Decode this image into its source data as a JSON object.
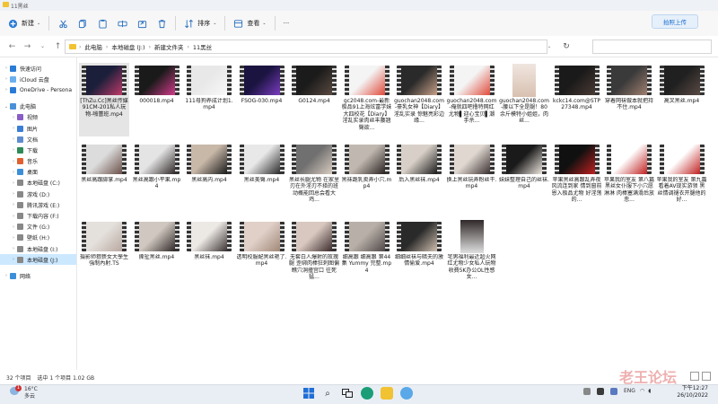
{
  "window": {
    "title": "11黑丝"
  },
  "toolbar": {
    "new_label": "新建",
    "sort_label": "排序",
    "view_label": "查看",
    "more_label": "···",
    "sync_label": "拍照上传"
  },
  "nav": {
    "back": "←",
    "forward": "→",
    "up": "↑",
    "recent": "⌄",
    "breadcrumbs": [
      "此电脑",
      "本地磁盘 (J:)",
      "新建文件夹",
      "11黑丝"
    ],
    "refresh": "↻"
  },
  "sidebar": {
    "items": [
      {
        "label": "快速访问",
        "color": "#2a7bd5",
        "arrow": "›"
      },
      {
        "label": "iCloud 云盘",
        "color": "#6ab0f0",
        "arrow": "›"
      },
      {
        "label": "OneDrive - Persona",
        "color": "#2a7bd5",
        "arrow": "›"
      },
      {
        "label": "此电脑",
        "color": "#4a90d9",
        "arrow": "⌄"
      },
      {
        "label": "视频",
        "color": "#8a5cc7",
        "arrow": "›"
      },
      {
        "label": "图片",
        "color": "#3a7ed6",
        "arrow": "›"
      },
      {
        "label": "文档",
        "color": "#5d8ccf",
        "arrow": "›"
      },
      {
        "label": "下载",
        "color": "#2e8b57",
        "arrow": "›"
      },
      {
        "label": "音乐",
        "color": "#e06030",
        "arrow": "›"
      },
      {
        "label": "桌面",
        "color": "#3b8fd9",
        "arrow": "›"
      },
      {
        "label": "本地磁盘 (C:)",
        "color": "#888888",
        "arrow": "›"
      },
      {
        "label": "游戏 (D:)",
        "color": "#888888",
        "arrow": "›"
      },
      {
        "label": "腾讯游戏 (E:)",
        "color": "#888888",
        "arrow": "›"
      },
      {
        "label": "下载内容 (F:)",
        "color": "#888888",
        "arrow": "›"
      },
      {
        "label": "文件 (G:)",
        "color": "#888888",
        "arrow": "›"
      },
      {
        "label": "壁纸 (H:)",
        "color": "#888888",
        "arrow": "›"
      },
      {
        "label": "本地磁盘 (I:)",
        "color": "#888888",
        "arrow": "›"
      },
      {
        "label": "本地磁盘 (J:)",
        "color": "#888888",
        "arrow": "›",
        "selected": true
      },
      {
        "label": "网络",
        "color": "#3b8fd9",
        "arrow": "›"
      }
    ]
  },
  "files": [
    {
      "label": "[ThZu.Cc]黑丝传媒91CM-201私人玩物-啪蕾班.mp4",
      "kind": "film",
      "c1": "#1b1f3a",
      "c2": "#c03a6a",
      "selected": true
    },
    {
      "label": "000018.mp4",
      "kind": "film",
      "c1": "#1a1a1a",
      "c2": "#d23a8a"
    },
    {
      "label": "111母狗养成计划1.mp4",
      "kind": "film",
      "c1": "#e8e8e8",
      "c2": "#f8f8f8"
    },
    {
      "label": "FSOG-030.mp4",
      "kind": "film",
      "c1": "#1b1440",
      "c2": "#7a3cc0"
    },
    {
      "label": "G0124.mp4",
      "kind": "film",
      "c1": "#1b1b1b",
      "c2": "#5a4a40"
    },
    {
      "label": "gc2048.com-最新极品91上海炫富学妹大四校花【Diary】淫乱实录肉丝丰腰翘臀欲...",
      "kind": "film",
      "c1": "#f4f4f4",
      "c2": "#e04a3a"
    },
    {
      "label": "guochan2048.com-豪乳女神【Diary】淫乱实录 惊魅亮彩边缘...",
      "kind": "film",
      "c1": "#2a2a2a",
      "c2": "#c8a088"
    },
    {
      "label": "guochan2048.com-俺就四吧撸特网红尤物▌迎心宝贝▌潮手杀...",
      "kind": "film",
      "c1": "#f4f4f4",
      "c2": "#e04a3a"
    },
    {
      "label": "guochan2048.com-腰以下全是腿！80余斤模特小姐姐，肉丝...",
      "kind": "tall",
      "c1": "#d8c0b0",
      "c2": "#f0e6e0"
    },
    {
      "label": "kckc14.com@STP27348.mp4",
      "kind": "film",
      "c1": "#1a1a1a",
      "c2": "#4a3a34"
    },
    {
      "label": "穿着网袜做本就把持不住.mp4",
      "kind": "film",
      "c1": "#3a3a3a",
      "c2": "#a08070"
    },
    {
      "label": "高叉黑丝.mp4",
      "kind": "film",
      "c1": "#202020",
      "c2": "#5a4a44"
    },
    {
      "label": "黑丝高跟脚掌.mp4",
      "kind": "film",
      "c1": "#dcdcdc",
      "c2": "#6a5048"
    },
    {
      "label": "黑丝高跟小平果.mp4",
      "kind": "film",
      "c1": "#e4e4e4",
      "c2": "#302828"
    },
    {
      "label": "黑丝高内.mp4",
      "kind": "film",
      "c1": "#c8b8a8",
      "c2": "#1a1a1a"
    },
    {
      "label": "黑丝美臀.mp4",
      "kind": "film",
      "c1": "#e8e8e8",
      "c2": "#2a2a2a"
    },
    {
      "label": "黑丝长腿尤物 在家里刃在外淫刃不择的班动概能回总会看大鸡...",
      "kind": "film",
      "c1": "#707070",
      "c2": "#d8ccc0"
    },
    {
      "label": "黑袜跪乳卖弄小穴.mp4",
      "kind": "film",
      "c1": "#c0b8b0",
      "c2": "#2a2220"
    },
    {
      "label": "后入黑丝袜.mp4",
      "kind": "film",
      "c1": "#d8d0c8",
      "c2": "#1a1a1a"
    },
    {
      "label": "换上黑丝玩弄粉丝干.mp4",
      "kind": "film",
      "c1": "#e0d8d0",
      "c2": "#3a3030"
    },
    {
      "label": "妹妹整理自己的丝袜.mp4",
      "kind": "film",
      "c1": "#1a1a1a",
      "c2": "#f0e8e0"
    },
    {
      "label": "苹果黑丝高跟乱弄夜风流连到家 情到窗前恩入极品尤物 好淫荡的...",
      "kind": "film",
      "c1": "#101010",
      "c2": "#c02020"
    },
    {
      "label": "苹果我的室友 第八篇 黑丝女仆服下小穴愿淋淋 肉棒塞满滑后放悲...",
      "kind": "film",
      "c1": "#ffffff",
      "c2": "#c02020"
    },
    {
      "label": "苹果我的室友 第九篇 看着AV现实游领 黑丝情调褪衣开腿他的好...",
      "kind": "film",
      "c1": "#ffffff",
      "c2": "#c02020"
    },
    {
      "label": "摄影师猥亵女大學生 強制內射.TS",
      "kind": "film",
      "c1": "#e4e0dc",
      "c2": "#b8a8a0"
    },
    {
      "label": "撕扯黑丝.mp4",
      "kind": "film",
      "c1": "#d0c8c0",
      "c2": "#302828"
    },
    {
      "label": "黑丝袜.mp4",
      "kind": "film",
      "c1": "#ece8e4",
      "c2": "#3a3232"
    },
    {
      "label": "透明校服配黑丝艳了.mp4",
      "kind": "film",
      "c1": "#e0d0c8",
      "c2": "#a08878"
    },
    {
      "label": "无套白人爆射的玫瑰腿 歪绑肉棒狂刺图偏瞧穴洞撞宫口 往死猛...",
      "kind": "film",
      "c1": "#d8c8c0",
      "c2": "#3a2a2a"
    },
    {
      "label": "细高跟 细高跟 第44集 Yummy 完整.mp4",
      "kind": "film",
      "c1": "#b8b0a8",
      "c2": "#504848"
    },
    {
      "label": "细细丝袜与暗夫的激情偷爱.mp4",
      "kind": "film",
      "c1": "#2a2a2a",
      "c2": "#d0c0b0"
    },
    {
      "label": "宅男福利最近超火网红尤物少女私人玩物收費5K办公OL性感女...",
      "kind": "tall",
      "c1": "#e0e0e0",
      "c2": "#302828"
    }
  ],
  "status": {
    "count": "32 个项目",
    "selected": "选中 1 个项目  1.02 GB"
  },
  "taskbar": {
    "temp": "16°C",
    "weather": "多云",
    "time": "下午12:27",
    "date": "26/10/2022",
    "lang": "ENG",
    "badge": "1"
  },
  "watermark": "老王论坛"
}
